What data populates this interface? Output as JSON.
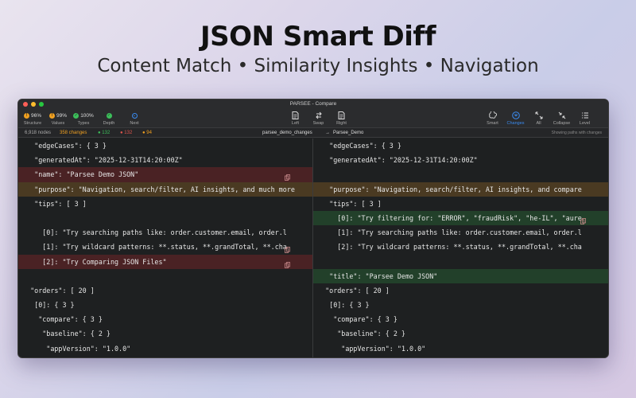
{
  "hero": {
    "title": "JSON Smart Diff",
    "subtitle": "Content Match • Similarity Insights • Navigation"
  },
  "window": {
    "title": "PARSEE - Compare"
  },
  "toolbar": {
    "left": [
      {
        "label": "Structure",
        "value": "96%",
        "color": "#f0a020",
        "icon": "warning-icon"
      },
      {
        "label": "Values",
        "value": "99%",
        "color": "#f0a020",
        "icon": "warning-icon"
      },
      {
        "label": "Types",
        "value": "100%",
        "color": "#3cbf5a",
        "icon": "check-icon"
      },
      {
        "label": "Depth",
        "value": "",
        "color": "#3cbf5a",
        "icon": "check-icon"
      },
      {
        "label": "Next",
        "value": "",
        "color": "#3a8bf0",
        "icon": "chevron-down-icon"
      }
    ],
    "center": [
      {
        "label": "Left",
        "icon": "document-icon"
      },
      {
        "label": "Swap",
        "icon": "swap-icon"
      },
      {
        "label": "Right",
        "icon": "document-icon"
      }
    ],
    "right": [
      {
        "label": "Smart",
        "icon": "brain-icon"
      },
      {
        "label": "Changes",
        "icon": "filter-icon"
      },
      {
        "label": "All",
        "icon": "expand-icon"
      },
      {
        "label": "Collapse",
        "icon": "collapse-icon"
      },
      {
        "label": "Level",
        "icon": "list-icon"
      }
    ]
  },
  "status": {
    "nodes": "6,918 nodes",
    "changes": "358 changes",
    "added": "● 132",
    "removed": "● 132",
    "modified": "● 94",
    "path_left": "parsee_demo_changes",
    "arrow": "→",
    "path_right": "Parsee_Demo",
    "hint": "Showing paths with changes"
  },
  "colors": {
    "removed": "#4a2224",
    "changed": "#4a3a22",
    "added": "#22402a"
  },
  "left_rows": [
    {
      "text": "    \"edgeCases\": { 3 }",
      "state": ""
    },
    {
      "text": "    \"generatedAt\": \"2025-12-31T14:20:00Z\"",
      "state": ""
    },
    {
      "text": "    \"name\": \"Parsee Demo JSON\"",
      "state": "removed",
      "copy": true
    },
    {
      "text": "    \"purpose\": \"Navigation, search/filter, AI insights, and much more",
      "state": "changed"
    },
    {
      "text": "    \"tips\": [ 3 ]",
      "state": ""
    },
    {
      "text": "",
      "state": ""
    },
    {
      "text": "      [0]: \"Try searching paths like: order.customer.email, order.l",
      "state": ""
    },
    {
      "text": "      [1]: \"Try wildcard patterns: **.status, **.grandTotal, **.cha",
      "state": "",
      "copy": true
    },
    {
      "text": "      [2]: \"Try Comparing JSON Files\"",
      "state": "removed",
      "copy": true
    },
    {
      "text": "",
      "state": ""
    },
    {
      "text": "   \"orders\": [ 20 ]",
      "state": ""
    },
    {
      "text": "    [0]: { 3 }",
      "state": ""
    },
    {
      "text": "     \"compare\": { 3 }",
      "state": ""
    },
    {
      "text": "      \"baseline\": { 2 }",
      "state": ""
    },
    {
      "text": "       \"appVersion\": \"1.0.0\"",
      "state": ""
    }
  ],
  "right_rows": [
    {
      "text": "    \"edgeCases\": { 3 }",
      "state": ""
    },
    {
      "text": "    \"generatedAt\": \"2025-12-31T14:20:00Z\"",
      "state": ""
    },
    {
      "text": "",
      "state": ""
    },
    {
      "text": "    \"purpose\": \"Navigation, search/filter, AI insights, and compare",
      "state": "changed"
    },
    {
      "text": "    \"tips\": [ 3 ]",
      "state": ""
    },
    {
      "text": "      [0]: \"Try filtering for: \"ERROR\", \"fraudRisk\", \"he-IL\", \"aure",
      "state": "added",
      "copy": true
    },
    {
      "text": "      [1]: \"Try searching paths like: order.customer.email, order.l",
      "state": ""
    },
    {
      "text": "      [2]: \"Try wildcard patterns: **.status, **.grandTotal, **.cha",
      "state": ""
    },
    {
      "text": "",
      "state": ""
    },
    {
      "text": "    \"title\": \"Parsee Demo JSON\"",
      "state": "added"
    },
    {
      "text": "   \"orders\": [ 20 ]",
      "state": ""
    },
    {
      "text": "    [0]: { 3 }",
      "state": ""
    },
    {
      "text": "     \"compare\": { 3 }",
      "state": ""
    },
    {
      "text": "      \"baseline\": { 2 }",
      "state": ""
    },
    {
      "text": "       \"appVersion\": \"1.0.0\"",
      "state": ""
    }
  ]
}
